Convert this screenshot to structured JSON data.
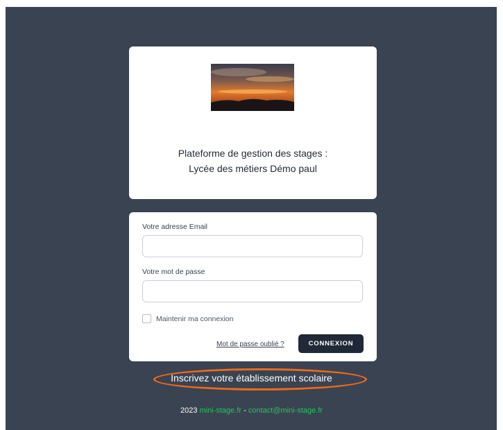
{
  "header": {
    "title_line1": "Plateforme de gestion des stages :",
    "title_line2": "Lycée des métiers Démo paul"
  },
  "login": {
    "email_label": "Votre adresse Email",
    "email_value": "",
    "password_label": "Votre mot de passe",
    "password_value": "",
    "remember_label": "Maintenir ma connexion",
    "remember_checked": false,
    "forgot_label": "Mot de passe oublié ?",
    "submit_label": "CONNEXION"
  },
  "register_label": "Inscrivez votre établissement scolaire",
  "footer": {
    "year": "2023",
    "site": "mini-stage.fr",
    "separator": "-",
    "email": "contact@mini-stage.fr"
  },
  "colors": {
    "background": "#3a4351",
    "button": "#1f2937",
    "link_green": "#22c55e",
    "highlight": "#f06a1a"
  }
}
